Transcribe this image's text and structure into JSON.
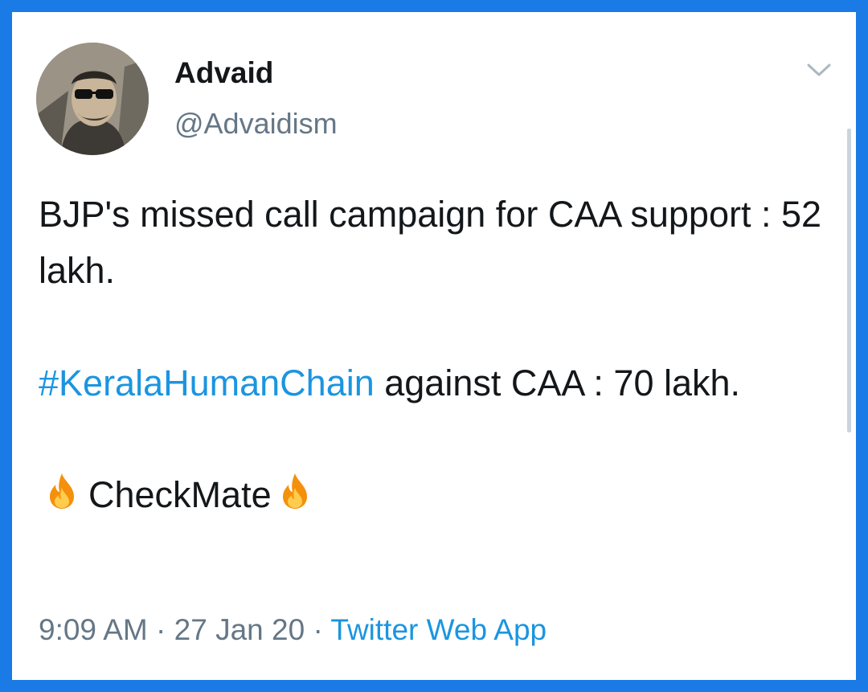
{
  "tweet": {
    "author_name": "Advaid",
    "author_handle": "@Advaidism",
    "line1": "BJP's missed call campaign for CAA support : 52 lakh.",
    "hashtag": "#KeralaHumanChain",
    "line2_rest": " against CAA : 70 lakh.",
    "closing_text": "CheckMate",
    "time": "9:09 AM",
    "sep1": " · ",
    "date": "27 Jan 20",
    "sep2": " · ",
    "source": "Twitter Web App"
  },
  "icons": {
    "menu": "chevron-down-icon",
    "emoji": "fire-icon"
  },
  "colors": {
    "border": "#1a7be6",
    "link": "#1b95e0",
    "muted": "#657786",
    "text": "#14171a"
  }
}
